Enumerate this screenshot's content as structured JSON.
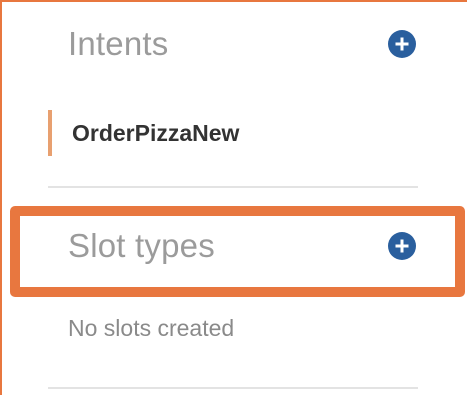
{
  "intents": {
    "title": "Intents",
    "add_icon": "plus-circle-icon",
    "items": [
      {
        "label": "OrderPizzaNew",
        "selected": true
      }
    ]
  },
  "slot_types": {
    "title": "Slot types",
    "add_icon": "plus-circle-icon",
    "empty_message": "No slots created"
  },
  "colors": {
    "highlight": "#e8773f",
    "add_button": "#2a5f9e",
    "section_title": "#9b9b9b",
    "item_text": "#333333"
  }
}
